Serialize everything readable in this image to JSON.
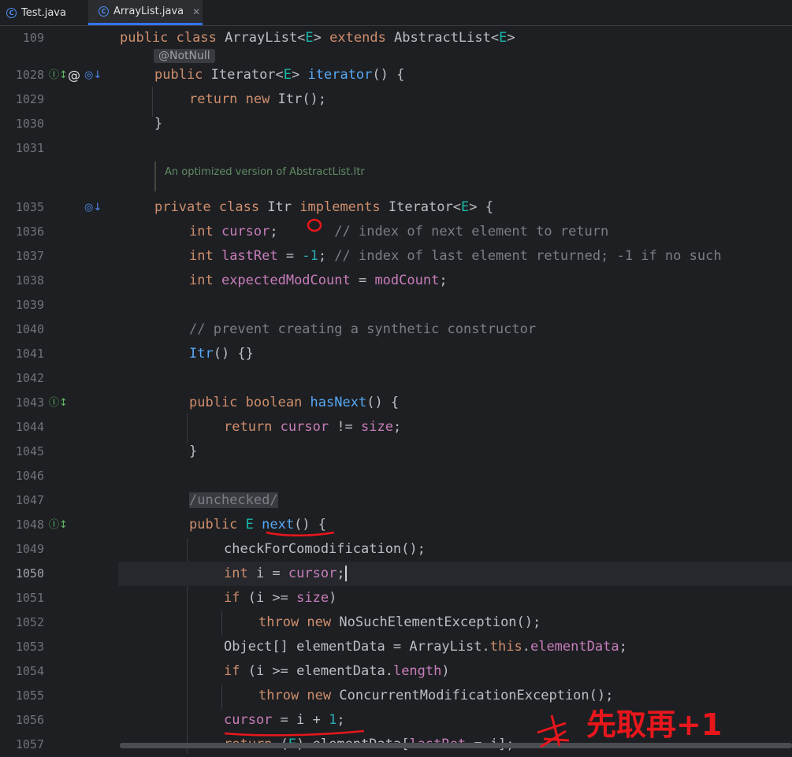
{
  "tabs": [
    {
      "label": "Test.java",
      "active": false
    },
    {
      "label": "ArrayList.java",
      "active": true
    }
  ],
  "sticky": {
    "line_number": "109",
    "code": "public class ArrayList<E> extends AbstractList<E>"
  },
  "inlay_hint": "@NotNull",
  "doc_comment": "An optimized version of AbstractList.Itr",
  "annotation_text": "先取再+1",
  "lines": [
    {
      "n": "1028"
    },
    {
      "n": "1029"
    },
    {
      "n": "1030"
    },
    {
      "n": "1031"
    },
    {
      "n": "1035"
    },
    {
      "n": "1036"
    },
    {
      "n": "1037"
    },
    {
      "n": "1038"
    },
    {
      "n": "1039"
    },
    {
      "n": "1040"
    },
    {
      "n": "1041"
    },
    {
      "n": "1042"
    },
    {
      "n": "1043"
    },
    {
      "n": "1044"
    },
    {
      "n": "1045"
    },
    {
      "n": "1046"
    },
    {
      "n": "1047"
    },
    {
      "n": "1048"
    },
    {
      "n": "1049"
    },
    {
      "n": "1050"
    },
    {
      "n": "1051"
    },
    {
      "n": "1052"
    },
    {
      "n": "1053"
    },
    {
      "n": "1054"
    },
    {
      "n": "1055"
    },
    {
      "n": "1056"
    },
    {
      "n": "1057"
    }
  ],
  "code": {
    "l1028": [
      "public ",
      "Iterator<",
      "E",
      "> ",
      "iterator",
      "() {"
    ],
    "l1029": [
      "return ",
      "new ",
      "Itr();"
    ],
    "l1030": "}",
    "l1035": [
      "private ",
      "class ",
      "Itr ",
      "implements ",
      "Iterator<",
      "E",
      "> {"
    ],
    "l1036": [
      "int ",
      "cursor",
      ";",
      "       // index of next element to return"
    ],
    "l1037": [
      "int ",
      "lastRet",
      " = ",
      "-1",
      "; ",
      "// index of last element returned; -1 if no such"
    ],
    "l1038": [
      "int ",
      "expectedModCount",
      " = ",
      "modCount",
      ";"
    ],
    "l1040": "// prevent creating a synthetic constructor",
    "l1041": [
      "Itr",
      "() {}"
    ],
    "l1043": [
      "public ",
      "boolean ",
      "hasNext",
      "() {"
    ],
    "l1044": [
      "return ",
      "cursor",
      " != ",
      "size",
      ";"
    ],
    "l1045": "}",
    "l1047": "/unchecked/",
    "l1048": [
      "public ",
      "E ",
      "next",
      "() {"
    ],
    "l1049": "checkForComodification();",
    "l1050": [
      "int ",
      "i = ",
      "cursor",
      ";"
    ],
    "l1051": [
      "if ",
      "(i >= ",
      "size",
      ")"
    ],
    "l1052": [
      "throw ",
      "new ",
      "NoSuchElementException();"
    ],
    "l1053": [
      "Object[] elementData = ArrayList.",
      "this",
      ".",
      "elementData",
      ";"
    ],
    "l1054": [
      "if ",
      "(i >= elementData.",
      "length",
      ")"
    ],
    "l1055": [
      "throw ",
      "new ",
      "ConcurrentModificationException();"
    ],
    "l1056": [
      "cursor",
      " = i + ",
      "1",
      ";"
    ],
    "l1057": [
      "return ",
      "(",
      "E",
      ") elementData[",
      "lastRet",
      " = i];"
    ]
  },
  "colors": {
    "background": "#1e1f22",
    "keyword": "#cf8e6d",
    "method": "#56a8f5",
    "field": "#c77dbb",
    "number": "#2aacb8",
    "type_param": "#16baac",
    "comment": "#7a7e85",
    "ink": "#e8171c"
  },
  "icons": {
    "test_tab": "java-class-icon",
    "arraylist_tab": "class-icon",
    "implementing": "implementing-method-icon",
    "overriding": "overriding-method-icon",
    "notnull": "annotation-at-icon"
  }
}
